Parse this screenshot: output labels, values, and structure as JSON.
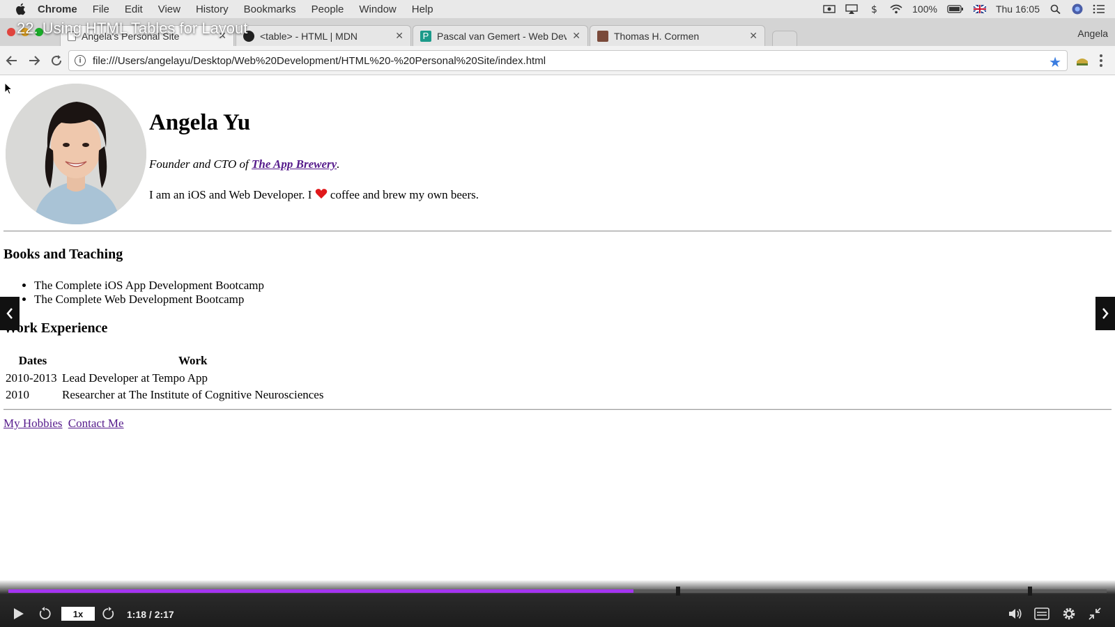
{
  "menubar": {
    "app": "Chrome",
    "items": [
      "File",
      "Edit",
      "View",
      "History",
      "Bookmarks",
      "People",
      "Window",
      "Help"
    ],
    "battery": "100%",
    "clock": "Thu 16:05"
  },
  "video": {
    "title": "22. Using HTML Tables for Layout",
    "speed": "1x",
    "time": "1:18 / 2:17",
    "progress_fraction": 0.569,
    "chapter_fractions": [
      0.61,
      0.93
    ],
    "accent_color": "#a435f0"
  },
  "tabs": [
    {
      "label": "Angela's Personal Site",
      "active": true,
      "favicon": "page-icon"
    },
    {
      "label": "<table> - HTML | MDN",
      "active": false,
      "favicon": "mdn-icon"
    },
    {
      "label": "Pascal van Gemert - Web Deve",
      "active": false,
      "favicon": "p-icon"
    },
    {
      "label": "Thomas H. Cormen",
      "active": false,
      "favicon": "portrait-icon"
    }
  ],
  "profile_name": "Angela",
  "address_bar": {
    "url": "file:///Users/angelayu/Desktop/Web%20Development/HTML%20-%20Personal%20Site/index.html"
  },
  "page": {
    "name": "Angela Yu",
    "tagline_prefix": "Founder and CTO of ",
    "tagline_link": "The App Brewery",
    "tagline_suffix": ".",
    "bio_before": "I am an iOS and Web Developer. I ",
    "bio_after": " coffee and brew my own beers.",
    "books_heading": "Books and Teaching",
    "books": [
      "The Complete iOS App Development Bootcamp",
      "The Complete Web Development Bootcamp"
    ],
    "work_heading": "Work Experience",
    "work_table": {
      "headers": [
        "Dates",
        "Work"
      ],
      "rows": [
        [
          "2010-2013",
          "Lead Developer at Tempo App"
        ],
        [
          "2010",
          "Researcher at The Institute of Cognitive Neurosciences"
        ]
      ]
    },
    "footer_links": [
      "My Hobbies",
      "Contact Me"
    ]
  }
}
